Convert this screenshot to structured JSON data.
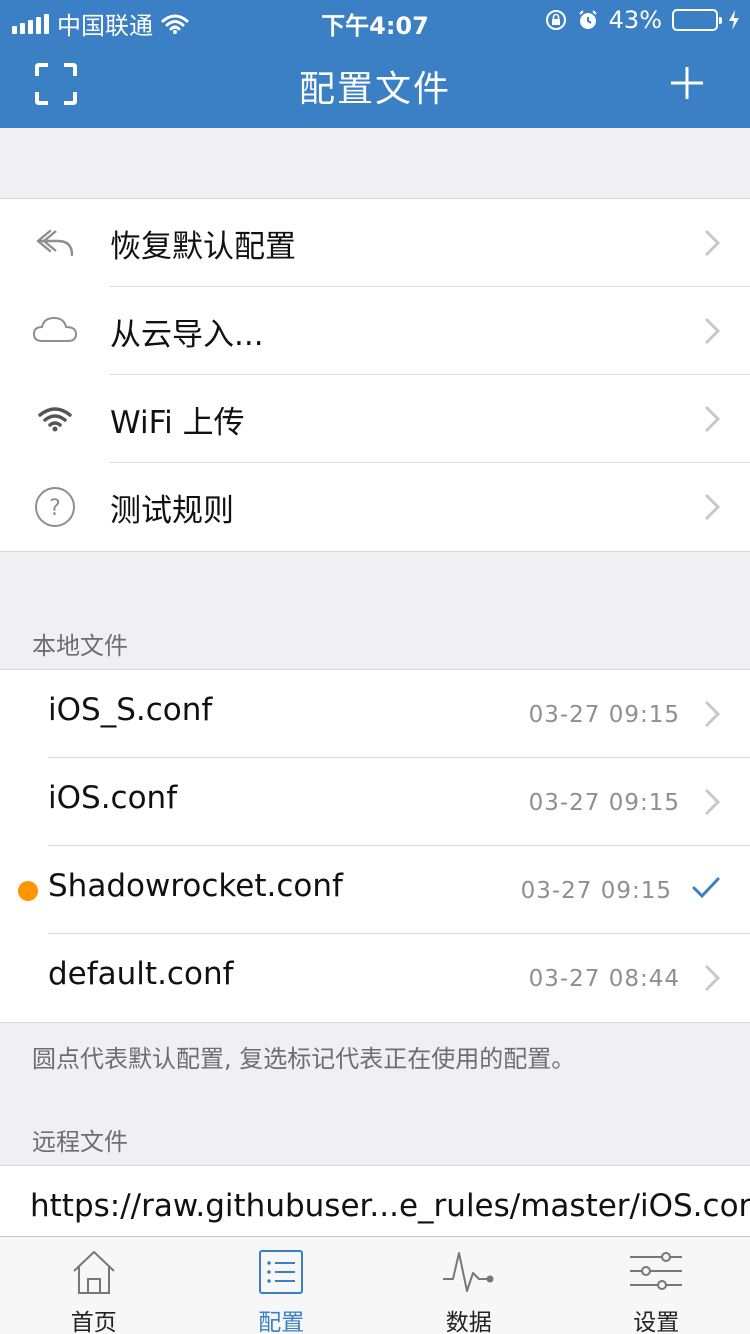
{
  "status_bar": {
    "carrier": "中国联通",
    "time": "下午4:07",
    "battery_percent": "43%",
    "battery_level": 0.43,
    "battery_color": "#4cd964"
  },
  "nav": {
    "title": "配置文件",
    "left_icon": "scan-icon",
    "right_icon": "plus-icon",
    "bar_color": "#3b7fc4"
  },
  "actions": [
    {
      "label": "恢复默认配置",
      "icon": "reply-icon"
    },
    {
      "label": "从云导入...",
      "icon": "cloud-icon"
    },
    {
      "label": "WiFi 上传",
      "icon": "wifi-icon"
    },
    {
      "label": "测试规则",
      "icon": "question-icon"
    }
  ],
  "local_files": {
    "header": "本地文件",
    "items": [
      {
        "name": "iOS_S.conf",
        "time": "03-27 09:15"
      },
      {
        "name": "iOS.conf",
        "time": "03-27 09:15"
      },
      {
        "name": "Shadowrocket.conf",
        "time": "03-27 09:15",
        "default": true,
        "selected": true
      },
      {
        "name": "default.conf",
        "time": "03-27 08:44"
      }
    ],
    "footnote": "圆点代表默认配置, 复选标记代表正在使用的配置。",
    "default_dot_color": "#ff9500",
    "check_color": "#3b7fc4"
  },
  "remote_files": {
    "header": "远程文件",
    "items": [
      {
        "url": "https://raw.githubuser...e_rules/master/iOS.conf"
      }
    ]
  },
  "tabbar": {
    "tabs": [
      {
        "label": "首页",
        "icon": "home-icon",
        "active": false
      },
      {
        "label": "配置",
        "icon": "list-icon",
        "active": true
      },
      {
        "label": "数据",
        "icon": "pulse-icon",
        "active": false
      },
      {
        "label": "设置",
        "icon": "sliders-icon",
        "active": false
      }
    ]
  }
}
